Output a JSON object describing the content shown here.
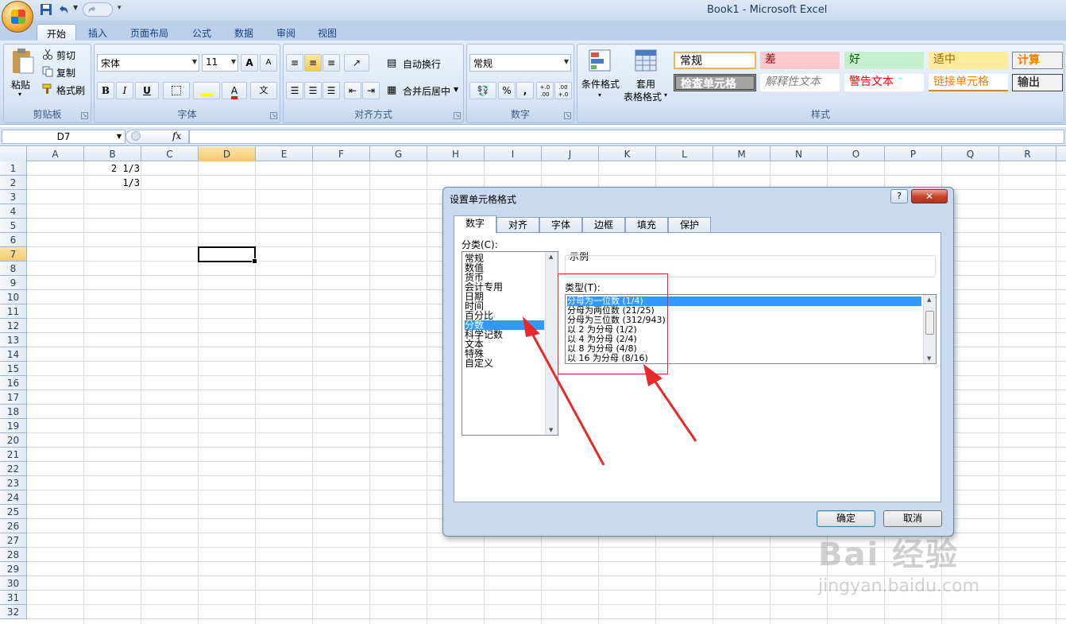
{
  "window": {
    "title": "Book1 - Microsoft Excel"
  },
  "ribbon_tabs": [
    "开始",
    "插入",
    "页面布局",
    "公式",
    "数据",
    "审阅",
    "视图"
  ],
  "clipboard": {
    "paste": "粘贴",
    "cut": "剪切",
    "copy": "复制",
    "format_painter": "格式刷",
    "label": "剪贴板"
  },
  "font": {
    "name": "宋体",
    "size": "11",
    "label": "字体",
    "bold": "B",
    "italic": "I",
    "underline": "U",
    "grow": "A",
    "shrink": "A",
    "font_color": "A",
    "phonetic": "文"
  },
  "alignment": {
    "wrap": "自动换行",
    "merge": "合并后居中",
    "label": "对齐方式"
  },
  "number": {
    "format": "常规",
    "percent": "%",
    "comma": ",",
    "inc_decimal": "+.0 .00",
    "dec_decimal": ".00 +.0",
    "label": "数字"
  },
  "styles": {
    "conditional": "条件格式",
    "table": "套用",
    "table2": "表格格式",
    "label": "样式",
    "cells": [
      "常规",
      "差",
      "好",
      "适中",
      "计算",
      "检查单元格",
      "解释性文本",
      "警告文本",
      "链接单元格",
      "输出"
    ]
  },
  "formula_bar": {
    "name_box": "D7",
    "fx": "fx",
    "value": ""
  },
  "columns": [
    "A",
    "B",
    "C",
    "D",
    "E",
    "F",
    "G",
    "H",
    "I",
    "J",
    "K",
    "L",
    "M",
    "N",
    "O",
    "P",
    "Q",
    "R"
  ],
  "rows": [
    "1",
    "2",
    "3",
    "4",
    "5",
    "6",
    "7",
    "8",
    "9",
    "10",
    "11",
    "12",
    "13",
    "14",
    "15",
    "16",
    "17",
    "18",
    "19",
    "20",
    "21",
    "22",
    "23",
    "24",
    "25",
    "26",
    "27",
    "28",
    "29",
    "30",
    "31",
    "32"
  ],
  "cells": {
    "B1": "2 1/3",
    "B2": "1/3"
  },
  "dialog": {
    "title": "设置单元格格式",
    "help": "?",
    "close": "✕",
    "tabs": [
      "数字",
      "对齐",
      "字体",
      "边框",
      "填充",
      "保护"
    ],
    "category_label": "分类(C):",
    "categories": [
      "常规",
      "数值",
      "货币",
      "会计专用",
      "日期",
      "时间",
      "百分比",
      "分数",
      "科学记数",
      "文本",
      "特殊",
      "自定义"
    ],
    "selected_category": "分数",
    "sample_label": "示例",
    "type_label": "类型(T):",
    "types": [
      "分母为一位数 (1/4)",
      "分母为两位数 (21/25)",
      "分母为三位数 (312/943)",
      "以 2 为分母 (1/2)",
      "以 4 为分母 (2/4)",
      "以 8 为分母 (4/8)",
      "以 16 为分母 (8/16)"
    ],
    "ok": "确定",
    "cancel": "取消"
  },
  "annotation_color": "#e8292a",
  "watermark": {
    "brand": "Bai  经验",
    "url": "jingyan.baidu.com"
  }
}
